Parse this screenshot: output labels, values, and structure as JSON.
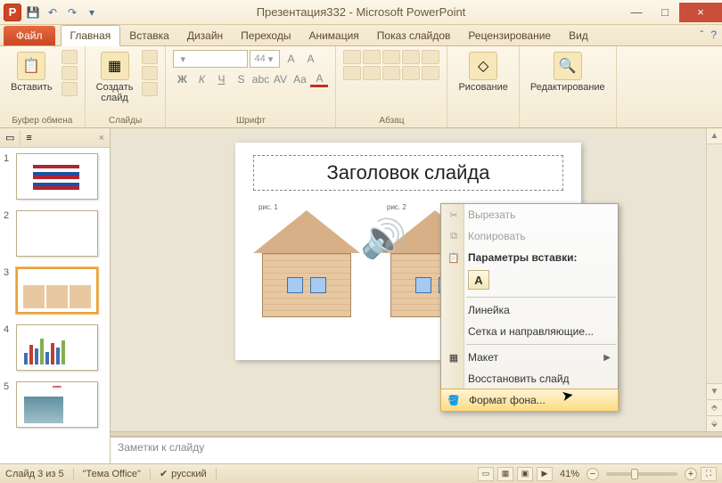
{
  "titlebar": {
    "title": "Презентация332 - Microsoft PowerPoint",
    "app_letter": "P"
  },
  "win": {
    "min": "—",
    "max": "□",
    "close": "×"
  },
  "tabs": {
    "file": "Файл",
    "items": [
      "Главная",
      "Вставка",
      "Дизайн",
      "Переходы",
      "Анимация",
      "Показ слайдов",
      "Рецензирование",
      "Вид"
    ],
    "active_index": 0
  },
  "ribbon": {
    "clipboard": {
      "paste": "Вставить",
      "label": "Буфер обмена"
    },
    "slides": {
      "new": "Создать\nслайд",
      "label": "Слайды"
    },
    "font": {
      "family_placeholder": "",
      "size_placeholder": "44",
      "label": "Шрифт"
    },
    "paragraph": {
      "label": "Абзац"
    },
    "drawing": {
      "btn": "Рисование",
      "label": ""
    },
    "editing": {
      "btn": "Редактирование",
      "label": ""
    }
  },
  "thumbs": {
    "slides": [
      {
        "num": "1"
      },
      {
        "num": "2"
      },
      {
        "num": "3",
        "selected": true
      },
      {
        "num": "4"
      },
      {
        "num": "5"
      }
    ]
  },
  "slide": {
    "title": "Заголовок слайда",
    "fig1": "рис. 1",
    "fig2": "рис. 2"
  },
  "notes": {
    "placeholder": "Заметки к слайду"
  },
  "context_menu": {
    "cut": "Вырезать",
    "copy": "Копировать",
    "paste_header": "Параметры вставки:",
    "paste_opt_letter": "А",
    "ruler": "Линейка",
    "grid": "Сетка и направляющие...",
    "layout": "Макет",
    "reset": "Восстановить слайд",
    "format_bg": "Формат фона..."
  },
  "status": {
    "slide_pos": "Слайд 3 из 5",
    "theme": "\"Тема Office\"",
    "lang": "русский",
    "zoom": "41%"
  }
}
